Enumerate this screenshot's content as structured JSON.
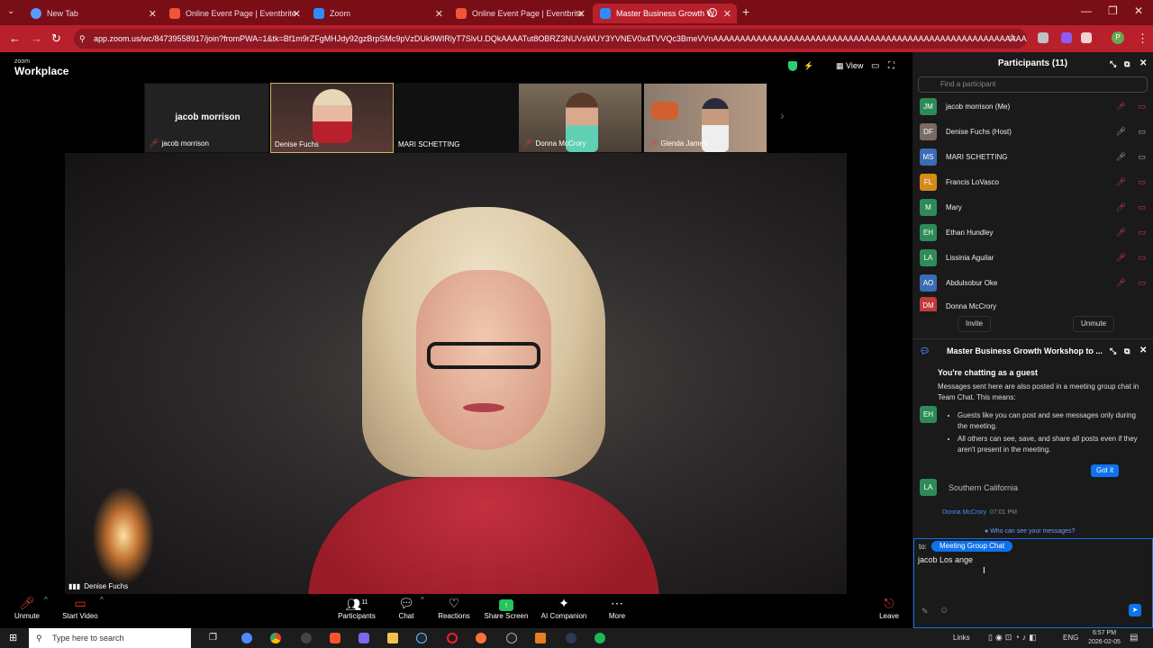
{
  "browser": {
    "tabs": [
      {
        "label": "New Tab",
        "fav": "#5a9bff"
      },
      {
        "label": "Online Event Page | Eventbrite",
        "fav": "#f05537"
      },
      {
        "label": "Zoom",
        "fav": "#2d8cff"
      },
      {
        "label": "Online Event Page | Eventbrite",
        "fav": "#f05537"
      },
      {
        "label": "Master Business Growth W",
        "fav": "#2d8cff"
      }
    ],
    "url": "app.zoom.us/wc/84739558917/join?fromPWA=1&tk=Bf1m9rZFgMHJdy92gzBrpSMc9pVzDUk9WIRlyT7SlvU.DQkAAAATut8OBRZ3NUVsWUY3YVNEV0x4TVVQc3BmeVVnAAAAAAAAAAAAAAAAAAAAAAAAAAAAAAAAAAAAAAAAAAAAAAAAAAAAAAAAAAAAA&pwd=1xm..."
  },
  "zoom": {
    "logo_small": "zoom",
    "logo_main": "Workplace",
    "view_label": "View",
    "thumbnails": [
      {
        "name": "jacob morrison",
        "big_name": "jacob morrison",
        "muted": true
      },
      {
        "name": "Denise Fuchs",
        "muted": false
      },
      {
        "name": "MARI SCHETTING",
        "muted": false
      },
      {
        "name": "Donna McCrory",
        "muted": true
      },
      {
        "name": "Glenda James",
        "muted": true
      }
    ],
    "active_speaker": "Denise Fuchs",
    "toolbar": {
      "unmute": "Unmute",
      "start_video": "Start Video",
      "participants": "Participants",
      "participants_count": "11",
      "chat": "Chat",
      "reactions": "Reactions",
      "share_screen": "Share Screen",
      "ai_companion": "AI Companion",
      "more": "More",
      "leave": "Leave"
    }
  },
  "participants": {
    "title": "Participants (11)",
    "search_placeholder": "Find a participant",
    "list": [
      {
        "initials": "JM",
        "name": "jacob morrison (Me)",
        "color": "#2e8b57",
        "mic_on": false,
        "cam_on": false
      },
      {
        "initials": "DF",
        "name": "Denise Fuchs (Host)",
        "color": "#7a6a66",
        "mic_on": true,
        "cam_on": true
      },
      {
        "initials": "MS",
        "name": "MARI SCHETTING",
        "color": "#3b6cb5",
        "mic_on": true,
        "cam_on": true
      },
      {
        "initials": "FL",
        "name": "Francis LoVasco",
        "color": "#d68a1a",
        "mic_on": false,
        "cam_on": false
      },
      {
        "initials": "M",
        "name": "Mary",
        "color": "#2e8b57",
        "mic_on": false,
        "cam_on": false
      },
      {
        "initials": "EH",
        "name": "Ethan Hundley",
        "color": "#2e8b57",
        "mic_on": false,
        "cam_on": false
      },
      {
        "initials": "LA",
        "name": "Lissinia Aguilar",
        "color": "#2e8b57",
        "mic_on": false,
        "cam_on": false
      },
      {
        "initials": "AO",
        "name": "Abdulsobur Oke",
        "color": "#3b6cb5",
        "mic_on": false,
        "cam_on": false
      },
      {
        "initials": "DM",
        "name": "Donna McCrory",
        "color": "#c23a3a",
        "mic_on": false,
        "cam_on": false
      }
    ],
    "invite": "Invite",
    "unmute": "Unmute"
  },
  "chat": {
    "title": "Master Business Growth Workshop to ...",
    "guest_title": "You're chatting as a guest",
    "guest_body": "Messages sent here are also posted in a meeting group chat in Team Chat. This means:",
    "bullet1": "Guests like you can post and see messages only during the meeting.",
    "bullet2": "All others can see, save, and share all posts even if they aren't present in the meeting.",
    "got_it": "Got it",
    "eh_initials": "EH",
    "la_initials": "LA",
    "la_message": "Southern California",
    "next_sender": "Donna McCrory",
    "next_time": "07:01 PM",
    "who_can_see": "Who can see your messages?",
    "to_label": "to:",
    "recipient": "Meeting Group Chat",
    "draft": "jacob Los ange"
  },
  "taskbar": {
    "search_placeholder": "Type here to search",
    "links": "Links",
    "lang": "ENG",
    "time": "6:57 PM",
    "date": "2026-02-05"
  }
}
